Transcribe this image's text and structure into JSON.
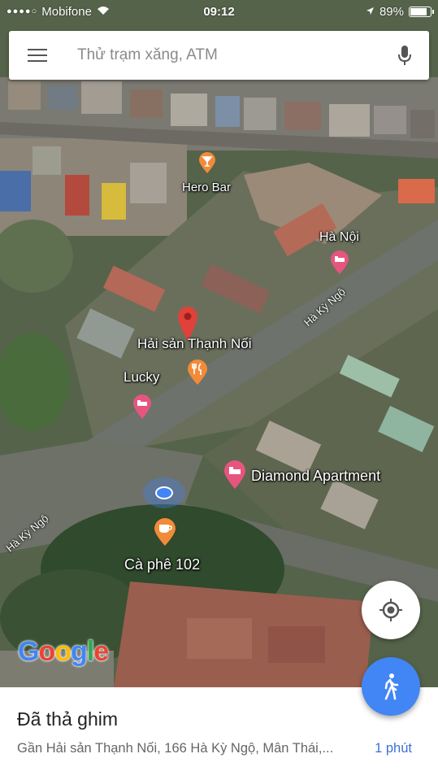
{
  "status_bar": {
    "carrier": "Mobifone",
    "time": "09:12",
    "battery_percent": "89%",
    "battery_level": 0.89
  },
  "search": {
    "placeholder": "Thử trạm xăng, ATM"
  },
  "map": {
    "pois": [
      {
        "name": "Hero Bar",
        "icon": "bar-icon"
      },
      {
        "name": "Hà Nội",
        "icon": "hotel-icon"
      },
      {
        "name": "Hải sản Thạnh Nối",
        "icon": "red-pin-icon"
      },
      {
        "name": "Lucky",
        "icon": "hotel-icon"
      },
      {
        "name": "Diamond Apartment",
        "icon": "hotel-icon"
      },
      {
        "name": "Cà phê 102",
        "icon": "cafe-icon"
      }
    ],
    "roads": [
      "Hà Kỳ Ngộ",
      "Hà Kỳ Ngộ"
    ],
    "logo": "Google"
  },
  "colors": {
    "accent_blue": "#4285f4",
    "poi_orange": "#f28b38",
    "poi_pink": "#e7557f",
    "pin_red": "#e0413a"
  },
  "bottom_sheet": {
    "title": "Đã thả ghim",
    "address": "Gần Hải sản Thạnh Nối, 166 Hà Kỳ Ngộ, Mân Thái,...",
    "travel_time": "1 phút"
  }
}
